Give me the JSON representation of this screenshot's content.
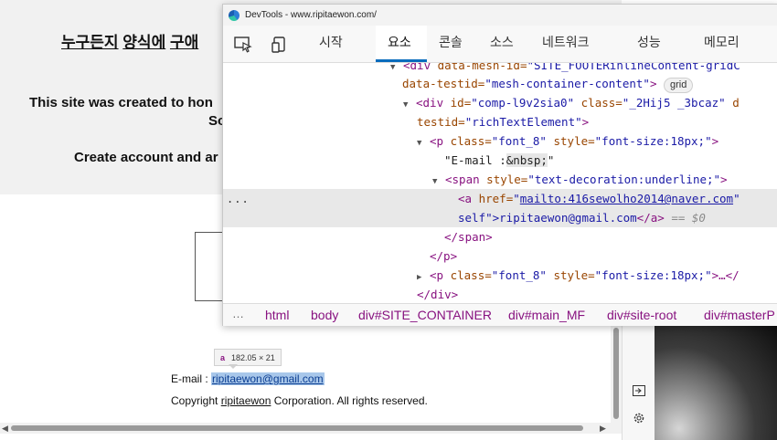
{
  "page": {
    "heading_left": "누구든지",
    "heading_mid": "양식에",
    "heading_right": "구애",
    "line1": "This site was created to hon",
    "line1b": "So",
    "line2": "Create account and ar",
    "tooltip_tag": "a",
    "tooltip_size": "182.05 × 21",
    "email_label": "E-mail :",
    "email_value": "ripitaewon@gmail.com",
    "copyright_prefix": "Copyright",
    "copyright_name": "ripitaewon",
    "copyright_suffix": "Corporation. All rights reserved."
  },
  "devtools": {
    "title": "DevTools - www.ripitaewon.com/",
    "tabs": [
      "시작",
      "요소",
      "콘솔",
      "소스",
      "네트워크",
      "성능",
      "메모리"
    ],
    "active_tab": "요소",
    "code": {
      "l1_tag": "<div",
      "l1_attr": "data-mesh-id=",
      "l1_val": "\"SITE_FOOTERinlineContent-gridC",
      "l2_attr": "data-testid=",
      "l2_val": "\"mesh-container-content\"",
      "l2_close": ">",
      "l2_pill": "grid",
      "l3_tag": "<div",
      "l3_attr1": "id=",
      "l3_val1": "\"comp-l9v2sia0\"",
      "l3_attr2": "class=",
      "l3_val2": "\"_2Hij5 _3bcaz\"",
      "l3_tail": "d",
      "l4_attr": "testid=",
      "l4_val": "\"richTextElement\"",
      "l4_close": ">",
      "l5_tag": "<p",
      "l5_attr1": "class=",
      "l5_val1": "\"font_8\"",
      "l5_attr2": "style=",
      "l5_val2": "\"font-size:18px;\"",
      "l5_close": ">",
      "l6_text": "\"E-mail :",
      "l6_entity": "&nbsp;",
      "l6_end": "\"",
      "l7_tag": "<span",
      "l7_attr": "style=",
      "l7_val": "\"text-decoration:underline;\"",
      "l7_close": ">",
      "l8_tag": "<a",
      "l8_attr": "href=",
      "l8_link": "mailto:416sewolho2014@naver.com",
      "l8_q": "\"",
      "l9_text": "self\">ripitaewon@gmail.com",
      "l9_tag": "</a>",
      "l9_dim": "== $0",
      "l10_tag": "</span>",
      "l11_tag": "</p>",
      "l12_tag": "<p",
      "l12_attr1": "class=",
      "l12_val1": "\"font_8\"",
      "l12_attr2": "style=",
      "l12_val2": "\"font-size:18px;\"",
      "l12_tail": ">…</",
      "l13_tag": "</div>"
    },
    "dots": "...",
    "breadcrumbs": [
      "html",
      "body",
      "div#SITE_CONTAINER",
      "div#main_MF",
      "div#site-root",
      "div#masterP"
    ],
    "crumb_more": "…"
  },
  "colors": {
    "accent": "#0a6cbd",
    "tag": "#881280",
    "attr_name": "#994500",
    "attr_value": "#1a1aa6",
    "selection": "#a8c7ea"
  },
  "icons": {
    "inspect": "inspect-element-icon",
    "device": "device-emulation-icon",
    "dock": "dock-icon",
    "settings": "settings-gear-icon"
  }
}
